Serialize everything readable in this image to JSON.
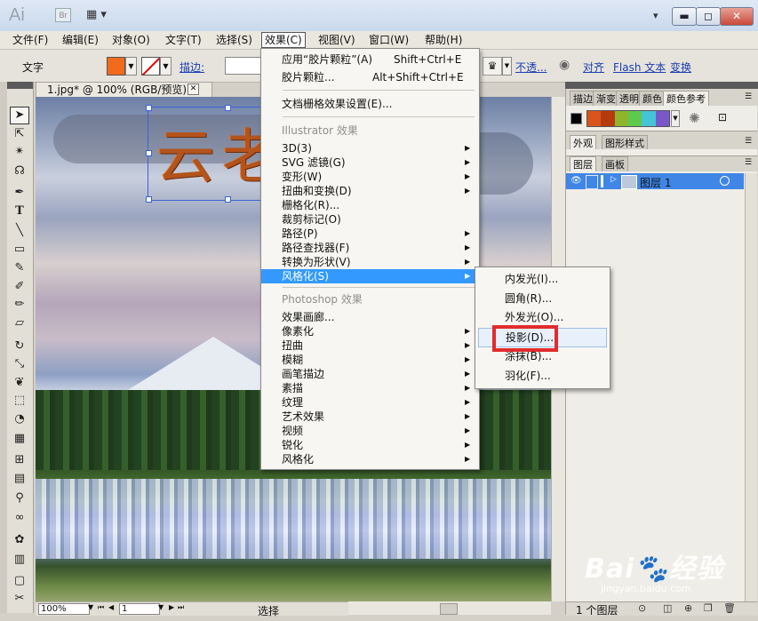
{
  "window": {
    "app_logo": "Ai",
    "bridge": "Br",
    "workspace": "▦ ▾",
    "workspace_arrow": "▾",
    "min": "▬",
    "max": "◻",
    "close": "✕"
  },
  "menubar": {
    "items": [
      "文件(F)",
      "编辑(E)",
      "对象(O)",
      "文字(T)",
      "选择(S)",
      "效果(C)",
      "视图(V)",
      "窗口(W)",
      "帮助(H)"
    ]
  },
  "control_bar": {
    "label": "文字",
    "stroke_label": "描边:",
    "opacity_link": "不透...",
    "align_link": "对齐",
    "flash_text_link": "Flash 文本",
    "transform_link": "变换"
  },
  "document": {
    "tab_title": "1.jpg* @ 100% (RGB/预览)",
    "tab_close": "✕",
    "art_text": "云老",
    "zoom": "100%",
    "page": "1",
    "status": "选择"
  },
  "right_panel": {
    "tabs_row1": [
      "描边",
      "渐变",
      "透明",
      "颜色",
      "颜色参考"
    ],
    "tabs_row2": [
      "外观",
      "图形样式"
    ],
    "tabs_row3": [
      "图层",
      "画板"
    ],
    "harmony_colors": [
      "#d9541c",
      "#b53b0f",
      "#8fb52f",
      "#5fc94e",
      "#45c4d6",
      "#7a57c9"
    ],
    "layer_name": "图层 1",
    "layers_count": "1 个图层"
  },
  "effect_menu": {
    "apply_last": {
      "label": "应用“胶片颗粒”(A)",
      "shortcut": "Shift+Ctrl+E"
    },
    "last_effect": {
      "label": "胶片颗粒...",
      "shortcut": "Alt+Shift+Ctrl+E"
    },
    "doc_raster": "文档栅格效果设置(E)...",
    "illustrator_header": "Illustrator 效果",
    "illustrator_items": [
      "3D(3)",
      "SVG 滤镜(G)",
      "变形(W)",
      "扭曲和变换(D)",
      "栅格化(R)...",
      "裁剪标记(O)",
      "路径(P)",
      "路径查找器(F)",
      "转换为形状(V)",
      "风格化(S)"
    ],
    "photoshop_header": "Photoshop 效果",
    "photoshop_items": [
      "效果画廊...",
      "像素化",
      "扭曲",
      "模糊",
      "画笔描边",
      "素描",
      "纹理",
      "艺术效果",
      "视频",
      "锐化",
      "风格化"
    ]
  },
  "stylize_submenu": {
    "items": [
      "内发光(I)...",
      "圆角(R)...",
      "外发光(O)...",
      "投影(D)...",
      "涂抹(B)...",
      "羽化(F)..."
    ]
  },
  "watermark": {
    "logo": "Bai🐾经验",
    "url": "jingyan.baidu.com"
  }
}
